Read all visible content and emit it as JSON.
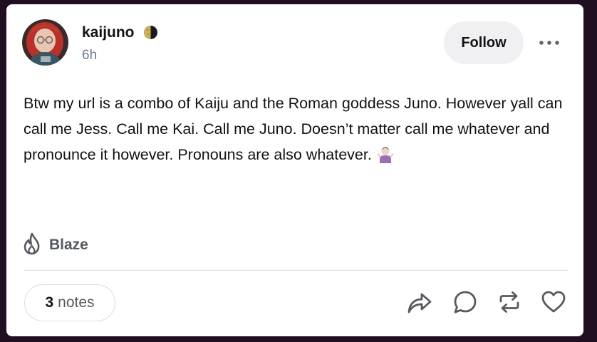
{
  "post": {
    "username": "kaijuno",
    "timestamp": "6h",
    "follow_label": "Follow",
    "body": "Btw my url is a combo of Kaiju and the Roman goddess Juno. However yall can call me Jess. Call me Kai. Call me Juno. Doesn’t matter call me whatever and pronounce it however. Pronouns are also whatever.",
    "blaze_label": "Blaze",
    "notes_count": "3",
    "notes_label": "notes"
  },
  "icons": {
    "badge": "moon-icon",
    "more": "ellipsis-icon",
    "blaze": "flame-icon",
    "share": "share-icon",
    "reply": "reply-icon",
    "reblog": "reblog-icon",
    "like": "heart-icon",
    "emoji": "person-shrugging-emoji"
  },
  "colors": {
    "page_background": "#1f0f20",
    "card_background": "#ffffff",
    "text_primary": "#121212",
    "text_secondary": "#6b7b8c",
    "follow_button_bg": "#f0f0f2"
  }
}
